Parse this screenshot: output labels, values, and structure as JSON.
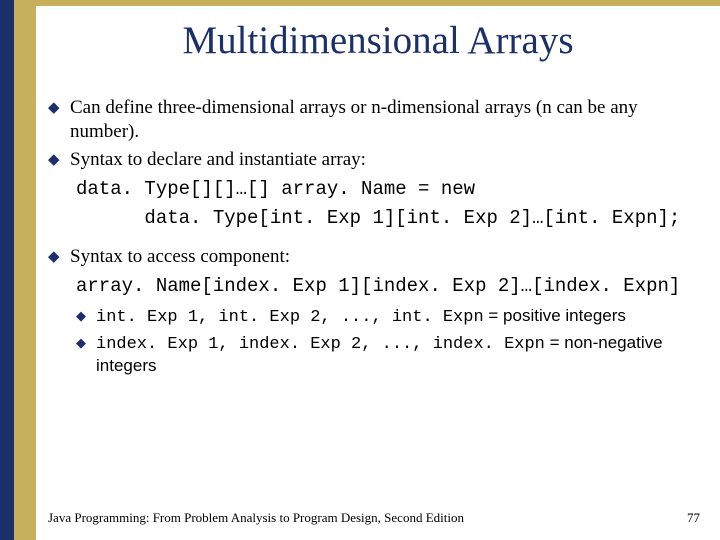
{
  "title": "Multidimensional Arrays",
  "bullets": {
    "b1": "Can define three-dimensional arrays or n-dimensional arrays (n can be any number).",
    "b2": "Syntax to declare and instantiate array:",
    "b3": "Syntax to access component:"
  },
  "code": {
    "decl1": "data. Type[][]…[] array. Name = new ",
    "decl2": "      data. Type[int. Exp 1][int. Exp 2]…[int. Expn];",
    "access": "array. Name[index. Exp 1][index. Exp 2]…[index. Expn]"
  },
  "sub": {
    "s1_code": "int. Exp 1, int. Exp 2, ..., int. Expn",
    "s1_tail": " = positive integers",
    "s2_code": "index. Exp 1, index. Exp 2, ..., index. Expn",
    "s2_tail": " = non-negative integers"
  },
  "footer": {
    "left": "Java Programming: From Problem Analysis to Program Design, Second Edition",
    "right": "77"
  }
}
